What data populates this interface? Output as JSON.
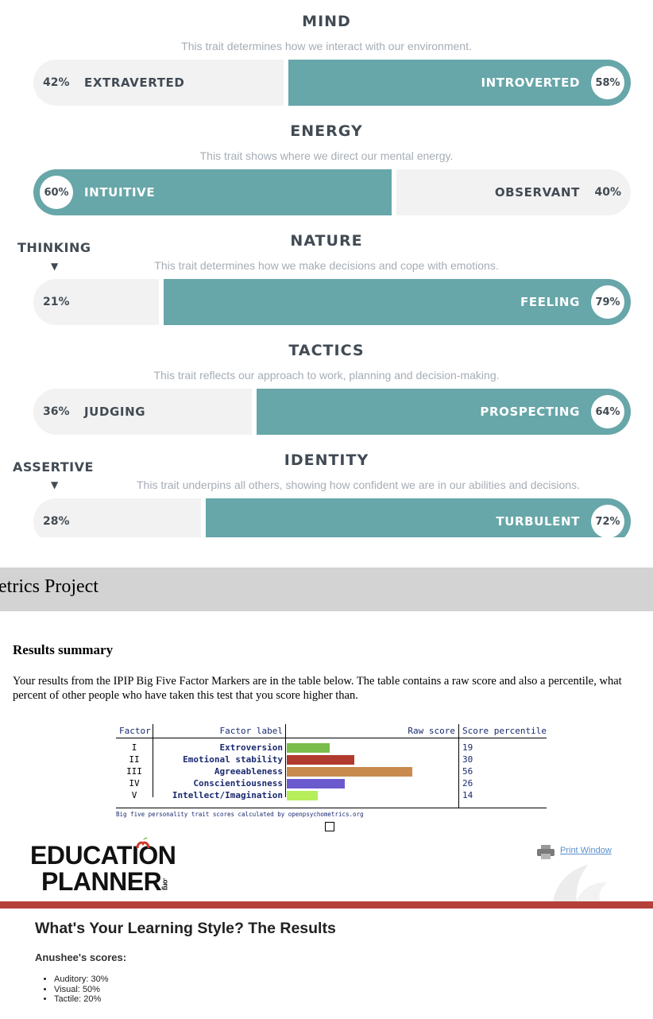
{
  "traits": [
    {
      "title": "MIND",
      "description": "This trait determines how we interact with our environment.",
      "left_label": "EXTRAVERTED",
      "left_pct": "42%",
      "right_label": "INTROVERTED",
      "right_pct": "58%",
      "left_value": 42,
      "dominant": "right"
    },
    {
      "title": "ENERGY",
      "description": "This trait shows where we direct our mental energy.",
      "left_label": "INTUITIVE",
      "left_pct": "60%",
      "right_label": "OBSERVANT",
      "right_pct": "40%",
      "left_value": 60,
      "dominant": "left"
    },
    {
      "title": "NATURE",
      "description": "This trait determines how we make decisions and cope with emotions.",
      "side_label": "THINKING",
      "left_label": "",
      "left_pct": "21%",
      "right_label": "FEELING",
      "right_pct": "79%",
      "left_value": 21,
      "dominant": "right"
    },
    {
      "title": "TACTICS",
      "description": "This trait reflects our approach to work, planning and decision-making.",
      "left_label": "JUDGING",
      "left_pct": "36%",
      "right_label": "PROSPECTING",
      "right_pct": "64%",
      "left_value": 36,
      "dominant": "right"
    },
    {
      "title": "IDENTITY",
      "description": "This trait underpins all others, showing how confident we are in our abilities and decisions.",
      "side_label": "ASSERTIVE",
      "left_label": "",
      "left_pct": "28%",
      "right_label": "TURBULENT",
      "right_pct": "72%",
      "left_value": 28,
      "dominant": "right"
    }
  ],
  "arrow_glyph": "▼",
  "banner": {
    "text": "etrics Project"
  },
  "summary": {
    "title": "Results summary",
    "text": "Your results from the IPIP Big Five Factor Markers are in the table below. The table contains a raw score and also a percentile, what percent of other people who have taken this test that you score higher than."
  },
  "factor_table": {
    "headers": {
      "factor": "Factor",
      "label": "Factor label",
      "raw": "Raw score",
      "percentile": "Score percentile"
    },
    "rows": [
      {
        "factor": "I",
        "label": "Extroversion",
        "raw_score": 19,
        "percentile": "19",
        "color": "#7bbd4a"
      },
      {
        "factor": "II",
        "label": "Emotional stability",
        "raw_score": 30,
        "percentile": "30",
        "color": "#b03a2e"
      },
      {
        "factor": "III",
        "label": "Agreeableness",
        "raw_score": 56,
        "percentile": "56",
        "color": "#c98a4e"
      },
      {
        "factor": "IV",
        "label": "Conscientiousness",
        "raw_score": 26,
        "percentile": "26",
        "color": "#6a5acd"
      },
      {
        "factor": "V",
        "label": "Intellect/Imagination",
        "raw_score": 14,
        "percentile": "14",
        "color": "#b5ee5a"
      }
    ],
    "caption": "Big five personality trait scores calculated by openpsychometrics.org"
  },
  "education_planner": {
    "logo_line1": "EDUCATION",
    "logo_line2": "PLANNER",
    "logo_suffix": ".org",
    "print_label": "Print Window",
    "title": "What's Your Learning Style? The Results",
    "subtitle": "Anushee's scores:",
    "scores": [
      "Auditory: 30%",
      "Visual: 50%",
      "Tactile: 20%"
    ]
  },
  "colors": {
    "teal": "#67a6a9",
    "track": "#f2f2f2",
    "text_dark": "#424b54",
    "muted": "#a5adb5",
    "stripe": "#b5403a",
    "banner": "#d3d3d3"
  }
}
